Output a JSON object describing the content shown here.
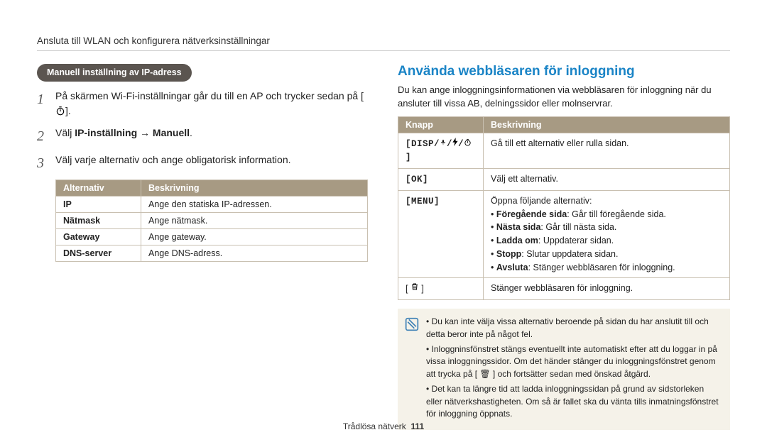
{
  "breadcrumb": "Ansluta till WLAN och konfigurera nätverksinställningar",
  "left": {
    "pill": "Manuell inställning av IP-adress",
    "steps": [
      {
        "num": "1",
        "text_before": "På skärmen Wi-Fi-inställningar går du till en AP och trycker sedan på [",
        "icon": "timer-icon",
        "text_after": "]."
      },
      {
        "num": "2",
        "prefix": "Välj ",
        "bold": "IP-inställning",
        "arrow": " → ",
        "bold2": "Manuell",
        "suffix": "."
      },
      {
        "num": "3",
        "plain": "Välj varje alternativ och ange obligatorisk information."
      }
    ],
    "table": {
      "head": [
        "Alternativ",
        "Beskrivning"
      ],
      "rows": [
        [
          "IP",
          "Ange den statiska IP-adressen."
        ],
        [
          "Nätmask",
          "Ange nätmask."
        ],
        [
          "Gateway",
          "Ange gateway."
        ],
        [
          "DNS-server",
          "Ange DNS-adress."
        ]
      ]
    }
  },
  "right": {
    "title": "Använda webbläsaren för inloggning",
    "intro": "Du kan ange inloggningsinformationen via webbläsaren för inloggning när du ansluter till vissa AB, delningssidor eller molnservrar.",
    "table": {
      "head": [
        "Knapp",
        "Beskrivning"
      ],
      "rows": [
        {
          "key": "[DISP/♣/⚡/☉]",
          "desc_simple": "Gå till ett alternativ eller rulla sidan."
        },
        {
          "key": "[OK]",
          "desc_simple": "Välj ett alternativ."
        },
        {
          "key": "[MENU]",
          "desc_intro": "Öppna följande alternativ:",
          "bullets": [
            {
              "b": "Föregående sida",
              "t": ": Går till föregående sida."
            },
            {
              "b": "Nästa sida",
              "t": ": Går till nästa sida."
            },
            {
              "b": "Ladda om",
              "t": ": Uppdaterar sidan."
            },
            {
              "b": "Stopp",
              "t": ": Slutar uppdatera sidan."
            },
            {
              "b": "Avsluta",
              "t": ": Stänger webbläsaren för inloggning."
            }
          ]
        },
        {
          "key_icon": "trash-icon",
          "key_brackets": [
            "[ ",
            " ]"
          ],
          "desc_simple": "Stänger webbläsaren för inloggning."
        }
      ]
    },
    "note": {
      "items": [
        "Du kan inte välja vissa alternativ beroende på sidan du har anslutit till och detta beror inte på något fel.",
        "Inloggninsfönstret stängs eventuellt inte automatiskt efter att du loggar in på vissa inloggningssidor. Om det händer stänger du inloggningsfönstret genom att trycka på [ 🗑 ] och fortsätter sedan med önskad åtgärd.",
        "Det kan ta längre tid att ladda inloggningssidan på grund av sidstorleken eller nätverkshastigheten. Om så är fallet ska du vänta tills inmatningsfönstret för inloggning öppnats."
      ]
    }
  },
  "footer": {
    "section": "Trådlösa nätverk",
    "page": "111"
  }
}
